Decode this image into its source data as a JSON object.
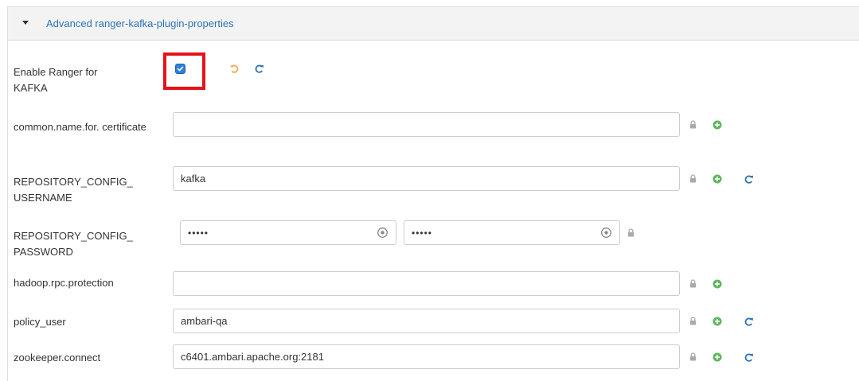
{
  "section": {
    "title": "Advanced ranger-kafka-plugin-properties"
  },
  "fields": {
    "enable_ranger": {
      "label": "Enable Ranger for KAFKA",
      "checked": true
    },
    "common_name": {
      "label": "common.name.for. certificate",
      "value": ""
    },
    "repo_username": {
      "label": "REPOSITORY_CONFIG_ USERNAME",
      "value": "kafka"
    },
    "repo_password": {
      "label": "REPOSITORY_CONFIG_ PASSWORD",
      "value": "•••••",
      "confirm_value": "•••••"
    },
    "hadoop_rpc": {
      "label": "hadoop.rpc.protection",
      "value": ""
    },
    "policy_user": {
      "label": "policy_user",
      "value": "ambari-qa"
    },
    "zookeeper": {
      "label": "zookeeper.connect",
      "value": "c6401.ambari.apache.org:2181"
    }
  },
  "colors": {
    "link_blue": "#2b73b8",
    "plus_green": "#5cb85c",
    "undo_orange": "#f0ad4e",
    "highlight_red": "#e3141b",
    "lock_gray": "#999999"
  }
}
